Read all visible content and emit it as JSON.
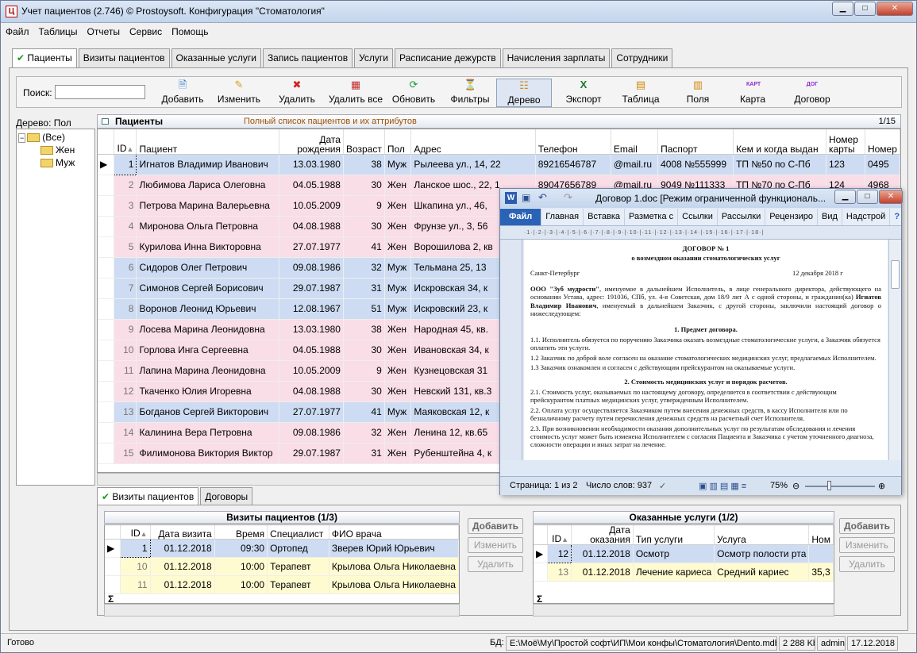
{
  "window": {
    "title": "Учет пациентов (2.746) © Prostoysoft. Конфигурация \"Стоматология\""
  },
  "menu": [
    "Файл",
    "Таблицы",
    "Отчеты",
    "Сервис",
    "Помощь"
  ],
  "tabs": [
    "Пациенты",
    "Визиты пациентов",
    "Оказанные услуги",
    "Запись пациентов",
    "Услуги",
    "Расписание дежурств",
    "Начисления зарплаты",
    "Сотрудники"
  ],
  "toolbar": {
    "search_label": "Поиск:",
    "search_value": "",
    "buttons": [
      "Добавить",
      "Изменить",
      "Удалить",
      "Удалить все",
      "Обновить",
      "Фильтры",
      "Дерево",
      "Экспорт",
      "Таблица",
      "Поля",
      "Карта",
      "Договор"
    ]
  },
  "tree": {
    "label": "Дерево: Пол",
    "root": "(Все)",
    "children": [
      "Жен",
      "Муж"
    ]
  },
  "patients": {
    "title": "Пациенты",
    "subtitle": "Полный список пациентов и их аттрибутов",
    "counter": "1/15",
    "columns": [
      "ID",
      "Пациент",
      "Дата рождения",
      "Возраст",
      "Пол",
      "Адрес",
      "Телефон",
      "Email",
      "Паспорт",
      "Кем и когда выдан",
      "Номер карты",
      "Номер"
    ],
    "rows": [
      {
        "id": "1",
        "name": "Игнатов Владимир Иванович",
        "dob": "13.03.1980",
        "age": "38",
        "sex": "Муж",
        "addr": "Рылеева ул., 14, 22",
        "phone": "89216546787",
        "email": "@mail.ru",
        "pass": "4008 №555999",
        "issued": "ТП №50 по С-Пб",
        "card": "123",
        "num": "0495"
      },
      {
        "id": "2",
        "name": "Любимова Лариса Олеговна",
        "dob": "04.05.1988",
        "age": "30",
        "sex": "Жен",
        "addr": "Ланское шос., 22, 1",
        "phone": "89047656789",
        "email": "@mail.ru",
        "pass": "9049 №111333",
        "issued": "ТП №70 по С-Пб",
        "card": "124",
        "num": "4968"
      },
      {
        "id": "3",
        "name": "Петрова Марина Валерьевна",
        "dob": "10.05.2009",
        "age": "9",
        "sex": "Жен",
        "addr": "Шкапина ул., 46,",
        "phone": "",
        "email": "",
        "pass": "",
        "issued": "",
        "card": "",
        "num": ""
      },
      {
        "id": "4",
        "name": "Миронова Ольга Петровна",
        "dob": "04.08.1988",
        "age": "30",
        "sex": "Жен",
        "addr": "Фрунзе ул., 3, 56",
        "phone": "",
        "email": "",
        "pass": "",
        "issued": "",
        "card": "",
        "num": ""
      },
      {
        "id": "5",
        "name": "Курилова Инна Викторовна",
        "dob": "27.07.1977",
        "age": "41",
        "sex": "Жен",
        "addr": "Ворошилова 2, кв",
        "phone": "",
        "email": "",
        "pass": "",
        "issued": "",
        "card": "",
        "num": ""
      },
      {
        "id": "6",
        "name": "Сидоров Олег Петрович",
        "dob": "09.08.1986",
        "age": "32",
        "sex": "Муж",
        "addr": "Тельмана 25, 13",
        "phone": "",
        "email": "",
        "pass": "",
        "issued": "",
        "card": "",
        "num": ""
      },
      {
        "id": "7",
        "name": "Симонов Сергей Борисович",
        "dob": "29.07.1987",
        "age": "31",
        "sex": "Муж",
        "addr": "Искровская 34, к",
        "phone": "",
        "email": "",
        "pass": "",
        "issued": "",
        "card": "",
        "num": ""
      },
      {
        "id": "8",
        "name": "Воронов Леонид Юрьевич",
        "dob": "12.08.1967",
        "age": "51",
        "sex": "Муж",
        "addr": "Искровский 23, к",
        "phone": "",
        "email": "",
        "pass": "",
        "issued": "",
        "card": "",
        "num": ""
      },
      {
        "id": "9",
        "name": "Лосева Марина Леонидовна",
        "dob": "13.03.1980",
        "age": "38",
        "sex": "Жен",
        "addr": "Народная 45, кв.",
        "phone": "",
        "email": "",
        "pass": "",
        "issued": "",
        "card": "",
        "num": ""
      },
      {
        "id": "10",
        "name": "Горлова Инга Сергеевна",
        "dob": "04.05.1988",
        "age": "30",
        "sex": "Жен",
        "addr": "Ивановская 34, к",
        "phone": "",
        "email": "",
        "pass": "",
        "issued": "",
        "card": "",
        "num": ""
      },
      {
        "id": "11",
        "name": "Лапина Марина Леонидовна",
        "dob": "10.05.2009",
        "age": "9",
        "sex": "Жен",
        "addr": "Кузнецовская 31",
        "phone": "",
        "email": "",
        "pass": "",
        "issued": "",
        "card": "",
        "num": ""
      },
      {
        "id": "12",
        "name": "Ткаченко Юлия Игоревна",
        "dob": "04.08.1988",
        "age": "30",
        "sex": "Жен",
        "addr": "Невский 131, кв.3",
        "phone": "",
        "email": "",
        "pass": "",
        "issued": "",
        "card": "",
        "num": ""
      },
      {
        "id": "13",
        "name": "Богданов Сергей Викторович",
        "dob": "27.07.1977",
        "age": "41",
        "sex": "Муж",
        "addr": "Маяковская 12, к",
        "phone": "",
        "email": "",
        "pass": "",
        "issued": "",
        "card": "",
        "num": ""
      },
      {
        "id": "14",
        "name": "Калинина Вера Петровна",
        "dob": "09.08.1986",
        "age": "32",
        "sex": "Жен",
        "addr": "Ленина 12, кв.65",
        "phone": "",
        "email": "",
        "pass": "",
        "issued": "",
        "card": "",
        "num": ""
      },
      {
        "id": "15",
        "name": "Филимонова Виктория Виктор",
        "dob": "29.07.1987",
        "age": "31",
        "sex": "Жен",
        "addr": "Рубенштейна 4, к",
        "phone": "",
        "email": "",
        "pass": "",
        "issued": "",
        "card": "",
        "num": ""
      }
    ]
  },
  "bottom_tabs": [
    "Визиты пациентов",
    "Договоры"
  ],
  "visits": {
    "title": "Визиты пациентов (1/3)",
    "columns": [
      "ID",
      "Дата визита",
      "Время",
      "Специалист",
      "ФИО врача"
    ],
    "rows": [
      {
        "id": "1",
        "date": "01.12.2018",
        "time": "09:30",
        "spec": "Ортопед",
        "doc": "Зверев Юрий Юрьевич"
      },
      {
        "id": "10",
        "date": "01.12.2018",
        "time": "10:00",
        "spec": "Терапевт",
        "doc": "Крылова Ольга Николаевна"
      },
      {
        "id": "11",
        "date": "01.12.2018",
        "time": "10:00",
        "spec": "Терапевт",
        "doc": "Крылова Ольга Николаевна"
      }
    ],
    "sum_symbol": "Σ"
  },
  "services": {
    "title": "Оказанные услуги (1/2)",
    "columns": [
      "ID",
      "Дата оказания",
      "Тип услуги",
      "Услуга",
      "Ном"
    ],
    "rows": [
      {
        "id": "12",
        "date": "01.12.2018",
        "type": "Осмотр",
        "svc": "Осмотр полости рта",
        "num": ""
      },
      {
        "id": "13",
        "date": "01.12.2018",
        "type": "Лечение кариеса",
        "svc": "Средний кариес",
        "num": "35,3"
      }
    ],
    "sum_symbol": "Σ"
  },
  "side_buttons": [
    "Добавить",
    "Изменить",
    "Удалить"
  ],
  "status": {
    "left": "Готово",
    "db_label": "БД:",
    "db_path": "E:\\Моё\\Му\\Простой софт\\ИП\\Мои конфы\\Стоматология\\Dento.mdb",
    "size": "2 288 Kb",
    "user": "admin",
    "date": "17.12.2018"
  },
  "word": {
    "title": "Договор 1.doc [Режим ограниченной функциональ...",
    "ribbon": [
      "Файл",
      "Главная",
      "Вставка",
      "Разметка с",
      "Ссылки",
      "Рассылки",
      "Рецензиро",
      "Вид",
      "Надстрой"
    ],
    "doc_title": "ДОГОВОР № 1",
    "doc_subtitle": "о возмездном оказании стоматологических услуг",
    "city": "Санкт-Петербург",
    "date": "12 декабря 2018 г",
    "para1_bold": "ООО \"Зуб мудрости\"",
    "para1": ", именуемое в дальнейшем Исполнитель, в лице генерального директора, действующего на основании Устава, адрес: 191036, СПб, ул. 4-я Советская, дом 18/9 лит А с одной стороны, и гражданин(ка)",
    "para1_name": "Игнатов Владимир Иванович",
    "para1_end": ", именуемый в дальнейшем Заказчик, с другой стороны, заключили настоящий договор о нижеследующем:",
    "sec1": "1. Предмет договора.",
    "p11": "1.1. Исполнитель обязуется по поручению Заказчика оказать возмездные стоматологические услуги, а Заказчик обязуется оплатить эти услуги.",
    "p12": "1.2 Заказчик по доброй воле согласен на оказание стоматологических медицинских услуг, предлагаемых Исполнителем.",
    "p13": "1.3 Заказчик ознакомлен и согласен с действующим прейскурантом на оказываемые услуги.",
    "sec2": "2. Стоимость медицинских услуг и порядок расчетов.",
    "p21": "2.1. Стоимость услуг, оказываемых по настоящему договору, определяется в соответствии с действующим прейскурантом платных медицинских услуг, утвержденным Исполнителем.",
    "p22": "2.2. Оплата услуг осуществляется Заказчиком путем внесения денежных средств, в кассу Исполнителя или по безналичному расчету путем перечисления денежных средств на расчетный счет Исполнителя.",
    "p23": "2.3. При возникновении необходимости оказания дополнительных услуг по результатам обследования и лечения стоимость услуг может быть изменена Исполнителем с согласия Пациента и Заказчика с учетом уточненного диагноза, сложности операции и иных затрат на лечение.",
    "status_page": "Страница: 1 из 2",
    "status_words": "Число слов: 937",
    "zoom": "75%"
  }
}
